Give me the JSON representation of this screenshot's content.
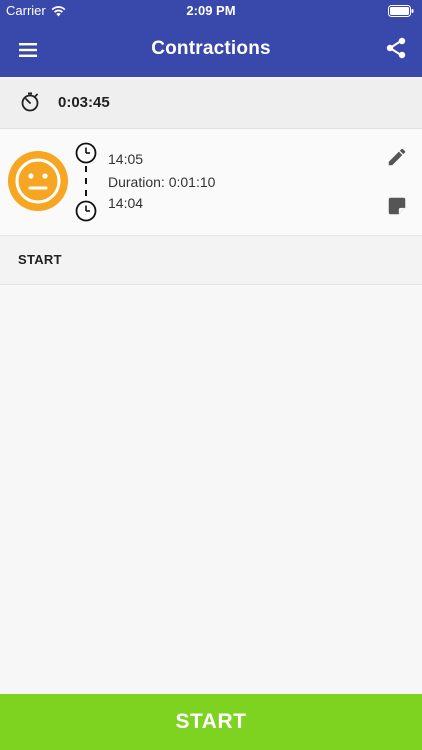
{
  "status_bar": {
    "carrier": "Carrier",
    "time": "2:09 PM"
  },
  "app_bar": {
    "title": "Contractions",
    "menu_icon": "hamburger-menu-icon",
    "share_icon": "share-icon",
    "color": "#3949ab"
  },
  "timer": {
    "icon": "stopwatch-icon",
    "value": "0:03:45"
  },
  "entries": [
    {
      "mood_icon": "neutral-face-icon",
      "mood_color": "#f6a623",
      "end_time": "14:05",
      "duration": "Duration: 0:01:10",
      "start_time": "14:04",
      "edit_icon": "pencil-icon",
      "note_icon": "note-icon"
    }
  ],
  "section": {
    "label": "START"
  },
  "bottom_button": {
    "label": "START",
    "color": "#7ed321"
  }
}
